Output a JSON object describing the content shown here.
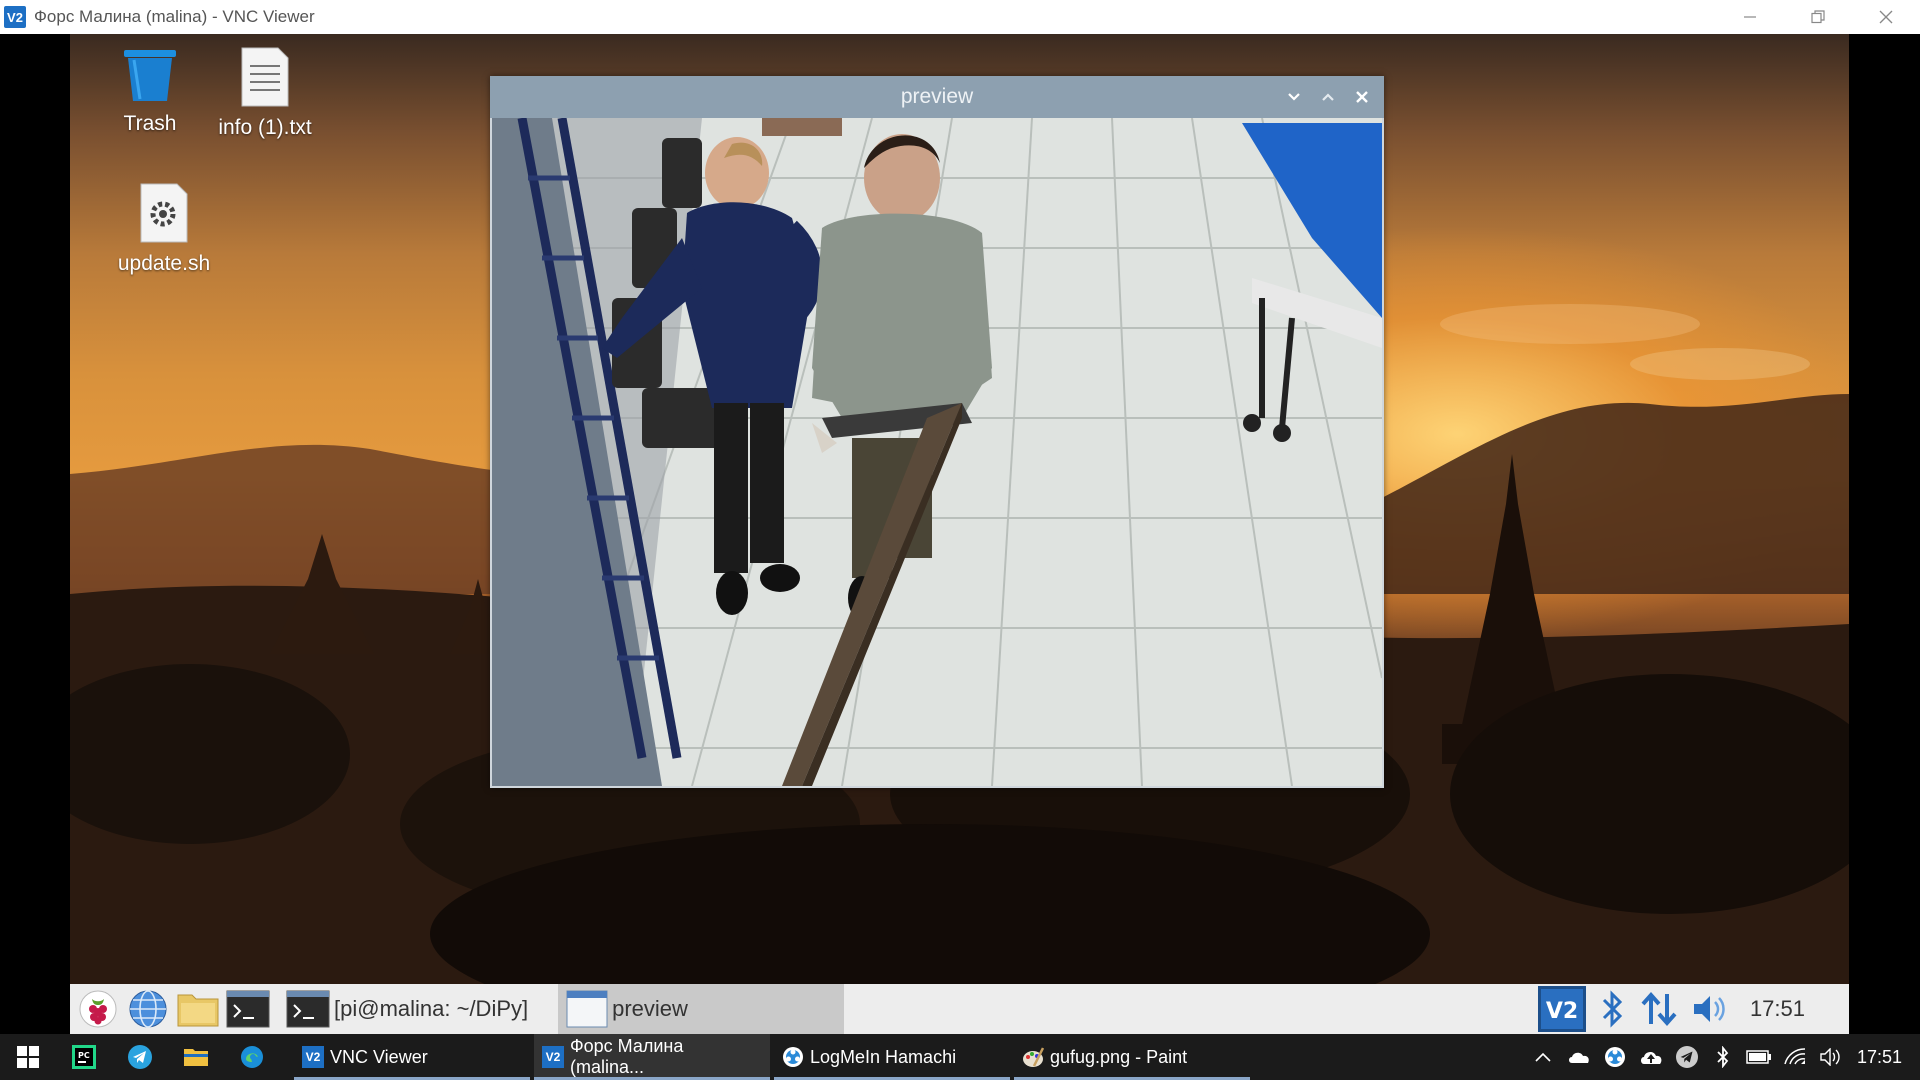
{
  "window": {
    "app_icon": "V2",
    "title": "Форс Малина (malina) - VNC Viewer",
    "minimize_icon": "minimize-icon",
    "restore_icon": "restore-icon",
    "close_icon": "close-icon"
  },
  "desktop": {
    "icons": [
      {
        "label": "Trash",
        "icon": "trash-icon"
      },
      {
        "label": "info (1).txt",
        "icon": "text-file-icon"
      },
      {
        "label": "update.sh",
        "icon": "script-file-icon"
      }
    ]
  },
  "preview_window": {
    "title": "preview",
    "controls": [
      "minimize-icon",
      "maximize-icon",
      "close-icon"
    ],
    "content": "camera-feed"
  },
  "pi_panel": {
    "launchers": [
      "raspberry-menu-icon",
      "web-browser-icon",
      "file-manager-icon",
      "terminal-icon"
    ],
    "tasks": [
      {
        "label": "[pi@malina: ~/DiPy]",
        "icon": "terminal-icon",
        "active": false
      },
      {
        "label": "preview",
        "icon": "window-icon",
        "active": true
      }
    ],
    "tray": [
      "vnc-icon",
      "bluetooth-icon",
      "network-icon",
      "volume-icon"
    ],
    "clock": "17:51"
  },
  "taskbar": {
    "pinned": [
      "windows-start-icon",
      "pycharm-icon",
      "telegram-icon",
      "file-explorer-icon",
      "edge-icon"
    ],
    "apps": [
      {
        "label": "VNC Viewer",
        "icon": "vnc-icon"
      },
      {
        "label": "Форс Малина (malina...",
        "icon": "vnc-icon"
      },
      {
        "label": "LogMeIn Hamachi",
        "icon": "hamachi-icon"
      },
      {
        "label": "gufug.png - Paint",
        "icon": "paint-icon"
      }
    ],
    "tray": [
      "chevron-up-icon",
      "onedrive-icon",
      "hamachi-icon",
      "cloud-upload-icon",
      "telegram-icon",
      "bluetooth-icon",
      "battery-icon",
      "wifi-icon",
      "speaker-icon"
    ],
    "clock": "17:51"
  },
  "colors": {
    "accent": "#1d6fc4",
    "preview_titlebar": "#8da0b0",
    "pi_panel": "#ededed",
    "taskbar": "#1b1b1b"
  }
}
